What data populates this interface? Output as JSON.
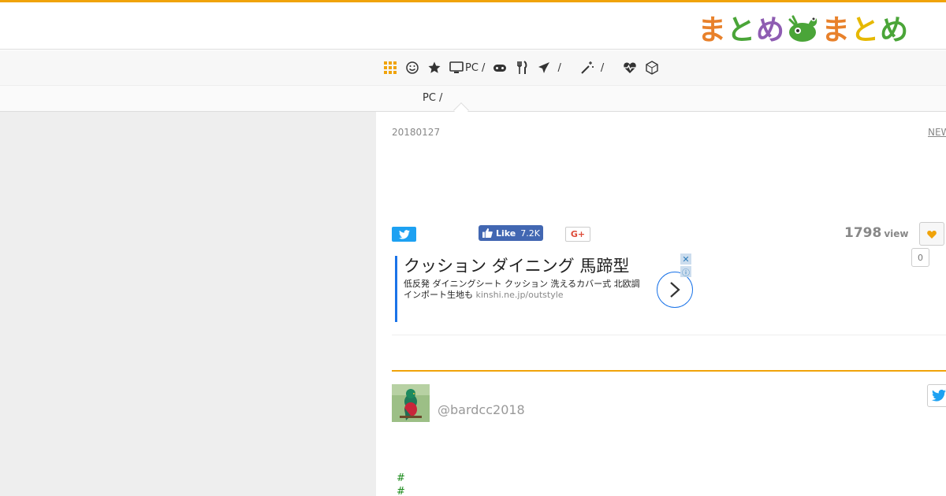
{
  "colors": {
    "accent": "#f0a30a",
    "logo_orange": "#e8812b",
    "logo_green": "#4aa538",
    "logo_purple": "#8e5cb2",
    "logo_yellow": "#e6b800",
    "twitter": "#1da1f2",
    "facebook": "#4267b2",
    "gplus": "#dd4b39"
  },
  "logo": {
    "left": "まとめ",
    "right": "まとめ"
  },
  "nav": {
    "items": [
      {
        "icon": "grid-icon",
        "label": ""
      },
      {
        "icon": "smile-icon",
        "label": ""
      },
      {
        "icon": "star-icon",
        "label": ""
      },
      {
        "icon": "monitor-icon",
        "label": "PC /"
      },
      {
        "icon": "gamepad-icon",
        "label": ""
      },
      {
        "icon": "utensils-icon",
        "label": ""
      },
      {
        "icon": "plane-icon",
        "label": "/"
      },
      {
        "icon": "magic-wand-icon",
        "label": "/"
      },
      {
        "icon": "heartbeat-icon",
        "label": ""
      },
      {
        "icon": "hexagon-icon",
        "label": ""
      }
    ]
  },
  "subnav": {
    "label": "PC /"
  },
  "article": {
    "date": "20180127",
    "new_link": "NEW",
    "views": "1798",
    "views_unit": "view",
    "fav_count": "0"
  },
  "share": {
    "fb_label": "Like",
    "fb_count": "7.2K",
    "gplus_label": "G+"
  },
  "ad": {
    "title": "クッション ダイニング 馬蹄型",
    "desc": "低反発 ダイニングシート クッション 洗えるカバー式 北欧調インポート生地も",
    "domain": "kinshi.ne.jp/outstyle"
  },
  "author": {
    "username": "@bardcc2018"
  },
  "tags": [
    "#",
    "#"
  ]
}
